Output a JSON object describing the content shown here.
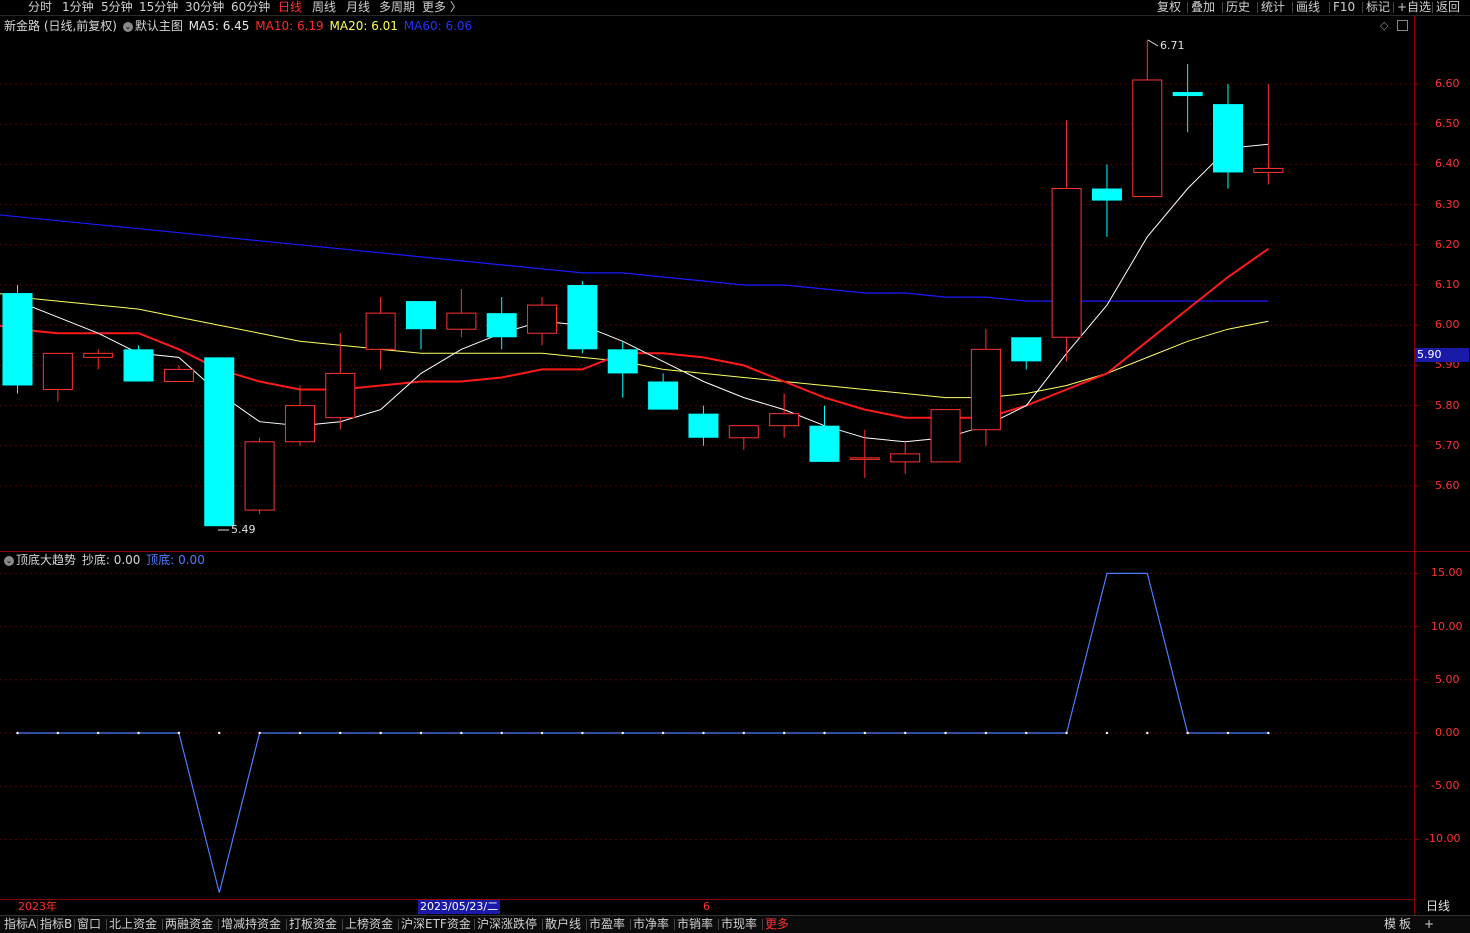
{
  "periods": [
    "分时",
    "1分钟",
    "5分钟",
    "15分钟",
    "30分钟",
    "60分钟",
    "日线",
    "周线",
    "月线",
    "多周期",
    "更多 〉"
  ],
  "active_period": "日线",
  "right_buttons": [
    "复权",
    "叠加",
    "历史",
    "统计",
    "画线",
    "F10",
    "标记",
    "+自选",
    "返回"
  ],
  "main_legend": {
    "stock": "新金路 (日线,前复权)",
    "chart_name": "默认主图",
    "ma5": "MA5: 6.45",
    "ma10": "MA10: 6.19",
    "ma20": "MA20: 6.01",
    "ma60": "MA60: 6.06"
  },
  "sub_legend": {
    "name": "顶底大趋势",
    "chaodi": "抄底: 0.00",
    "dingdi": "顶底: 0.00"
  },
  "price_axis": [
    "6.60",
    "6.50",
    "6.40",
    "6.30",
    "6.20",
    "6.10",
    "6.00",
    "5.90",
    "5.80",
    "5.70",
    "5.60"
  ],
  "current_price_tag": "5.90",
  "sub_axis": [
    "15.00",
    "10.00",
    "5.00",
    "0.00",
    "-5.00",
    "-10.00"
  ],
  "high_label": "6.71",
  "low_label": "5.49",
  "date_labels": {
    "year": "2023年",
    "cursor_date": "2023/05/23/二",
    "month": "6"
  },
  "period_badge": "日线",
  "bottom_tabs": [
    "指标A",
    "指标B",
    "窗口",
    "北上资金",
    "两融资金",
    "增减持资金",
    "打板资金",
    "上榜资金",
    "沪深ETF资金",
    "沪深涨跌停",
    "散户线",
    "市盈率",
    "市净率",
    "市销率",
    "市现率",
    "更多"
  ],
  "bottom_right": [
    "模",
    "板",
    "+"
  ],
  "colors": {
    "up": "#ff3232",
    "down": "#00ffff",
    "ma5": "#ffffff",
    "ma10": "#ff1a1a",
    "ma20": "#ffff66",
    "ma60": "#1a1aff",
    "sub_line": "#4d7dff"
  },
  "chart_data": {
    "type": "candlestick",
    "ylim": [
      5.49,
      6.71
    ],
    "candles": [
      {
        "o": 6.08,
        "h": 6.1,
        "l": 5.83,
        "c": 5.85
      },
      {
        "o": 5.84,
        "h": 5.93,
        "l": 5.81,
        "c": 5.93
      },
      {
        "o": 5.92,
        "h": 5.94,
        "l": 5.89,
        "c": 5.93
      },
      {
        "o": 5.94,
        "h": 5.95,
        "l": 5.86,
        "c": 5.86
      },
      {
        "o": 5.86,
        "h": 5.9,
        "l": 5.86,
        "c": 5.89
      },
      {
        "o": 5.92,
        "h": 5.92,
        "l": 5.5,
        "c": 5.5
      },
      {
        "o": 5.54,
        "h": 5.72,
        "l": 5.53,
        "c": 5.71
      },
      {
        "o": 5.71,
        "h": 5.85,
        "l": 5.7,
        "c": 5.8
      },
      {
        "o": 5.77,
        "h": 5.98,
        "l": 5.74,
        "c": 5.88
      },
      {
        "o": 5.94,
        "h": 6.07,
        "l": 5.89,
        "c": 6.03
      },
      {
        "o": 6.06,
        "h": 6.06,
        "l": 5.94,
        "c": 5.99
      },
      {
        "o": 5.99,
        "h": 6.09,
        "l": 5.97,
        "c": 6.03
      },
      {
        "o": 6.03,
        "h": 6.07,
        "l": 5.94,
        "c": 5.97
      },
      {
        "o": 5.98,
        "h": 6.07,
        "l": 5.95,
        "c": 6.05
      },
      {
        "o": 6.1,
        "h": 6.11,
        "l": 5.93,
        "c": 5.94
      },
      {
        "o": 5.94,
        "h": 5.96,
        "l": 5.82,
        "c": 5.88
      },
      {
        "o": 5.86,
        "h": 5.88,
        "l": 5.79,
        "c": 5.79
      },
      {
        "o": 5.78,
        "h": 5.8,
        "l": 5.7,
        "c": 5.72
      },
      {
        "o": 5.72,
        "h": 5.75,
        "l": 5.69,
        "c": 5.75
      },
      {
        "o": 5.75,
        "h": 5.83,
        "l": 5.72,
        "c": 5.78
      },
      {
        "o": 5.75,
        "h": 5.8,
        "l": 5.66,
        "c": 5.66
      },
      {
        "o": 5.67,
        "h": 5.74,
        "l": 5.62,
        "c": 5.67
      },
      {
        "o": 5.66,
        "h": 5.71,
        "l": 5.63,
        "c": 5.68
      },
      {
        "o": 5.66,
        "h": 5.79,
        "l": 5.66,
        "c": 5.79
      },
      {
        "o": 5.74,
        "h": 5.99,
        "l": 5.7,
        "c": 5.94
      },
      {
        "o": 5.97,
        "h": 5.97,
        "l": 5.89,
        "c": 5.91
      },
      {
        "o": 5.97,
        "h": 6.51,
        "l": 5.91,
        "c": 6.34
      },
      {
        "o": 6.34,
        "h": 6.4,
        "l": 6.22,
        "c": 6.31
      },
      {
        "o": 6.32,
        "h": 6.71,
        "l": 6.32,
        "c": 6.61
      },
      {
        "o": 6.58,
        "h": 6.65,
        "l": 6.48,
        "c": 6.57
      },
      {
        "o": 6.55,
        "h": 6.6,
        "l": 6.34,
        "c": 6.38
      },
      {
        "o": 6.38,
        "h": 6.6,
        "l": 6.35,
        "c": 6.39
      }
    ],
    "ma5": [
      6.06,
      6.02,
      5.98,
      5.93,
      5.92,
      5.83,
      5.76,
      5.75,
      5.76,
      5.79,
      5.88,
      5.94,
      5.98,
      6.01,
      6.0,
      5.96,
      5.91,
      5.86,
      5.82,
      5.79,
      5.75,
      5.72,
      5.71,
      5.72,
      5.75,
      5.8,
      5.93,
      6.05,
      6.22,
      6.34,
      6.44,
      6.45
    ],
    "ma10": [
      6.01,
      5.99,
      5.98,
      5.98,
      5.98,
      5.94,
      5.89,
      5.86,
      5.84,
      5.84,
      5.85,
      5.86,
      5.86,
      5.87,
      5.89,
      5.89,
      5.93,
      5.93,
      5.92,
      5.9,
      5.86,
      5.82,
      5.79,
      5.77,
      5.77,
      5.77,
      5.8,
      5.84,
      5.88,
      5.96,
      6.04,
      6.12,
      6.19
    ],
    "ma20": [
      6.09,
      6.07,
      6.06,
      6.05,
      6.04,
      6.02,
      6.0,
      5.98,
      5.96,
      5.95,
      5.94,
      5.93,
      5.93,
      5.93,
      5.93,
      5.92,
      5.91,
      5.89,
      5.88,
      5.87,
      5.86,
      5.85,
      5.84,
      5.83,
      5.82,
      5.82,
      5.83,
      5.85,
      5.88,
      5.92,
      5.96,
      5.99,
      6.01
    ],
    "ma60": [
      6.28,
      6.27,
      6.26,
      6.25,
      6.24,
      6.23,
      6.22,
      6.21,
      6.2,
      6.19,
      6.18,
      6.17,
      6.16,
      6.15,
      6.14,
      6.13,
      6.13,
      6.12,
      6.11,
      6.1,
      6.1,
      6.09,
      6.08,
      6.08,
      6.07,
      6.07,
      6.06,
      6.06,
      6.06,
      6.06,
      6.06,
      6.06,
      6.06
    ],
    "indicator": [
      0,
      0,
      0,
      0,
      0,
      -15,
      0,
      0,
      0,
      0,
      0,
      0,
      0,
      0,
      0,
      0,
      0,
      0,
      0,
      0,
      0,
      0,
      0,
      0,
      0,
      0,
      0,
      15,
      15,
      0,
      0,
      0
    ],
    "indicator_ylim": [
      -15,
      15
    ]
  }
}
